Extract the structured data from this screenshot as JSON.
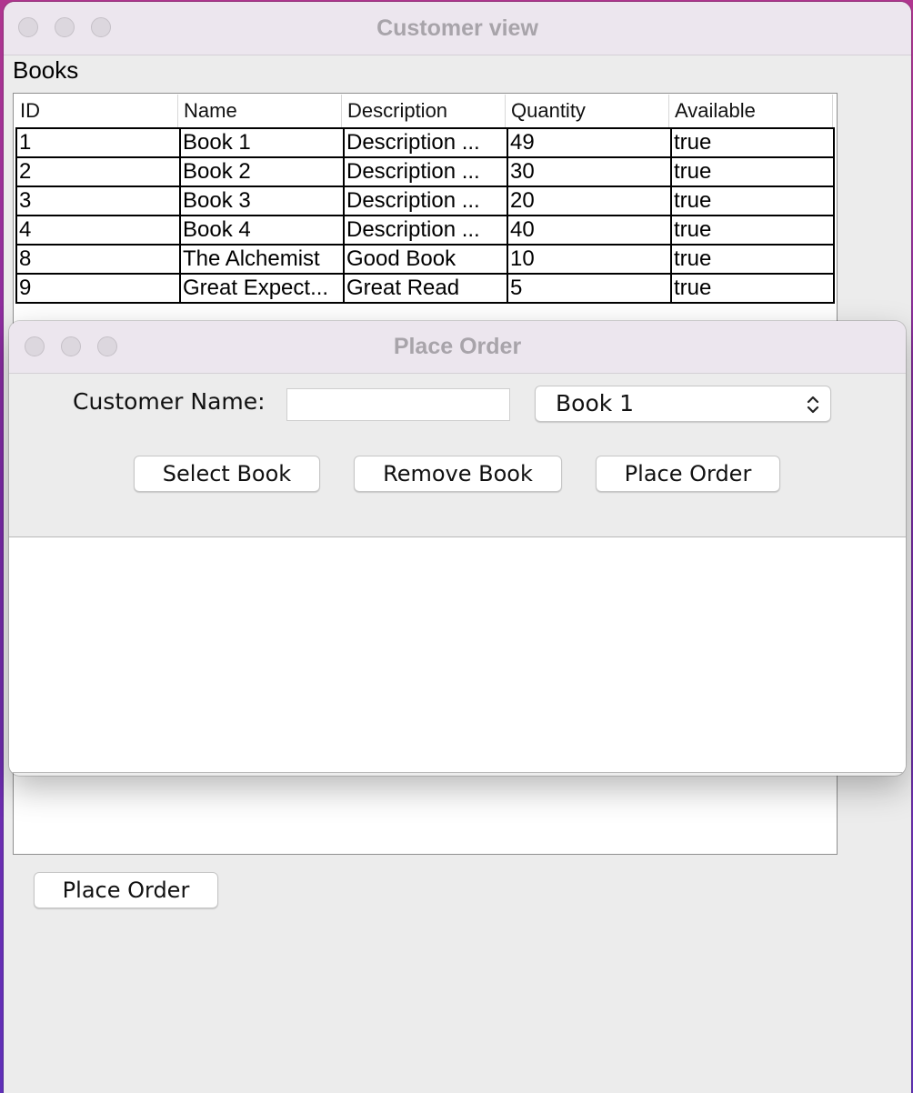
{
  "main_window": {
    "title": "Customer view",
    "books_heading": "Books",
    "place_order_label": "Place Order"
  },
  "table": {
    "columns": [
      "ID",
      "Name",
      "Description",
      "Quantity",
      "Available"
    ],
    "rows": [
      [
        "1",
        "Book 1",
        "Description ...",
        "49",
        "true"
      ],
      [
        "2",
        "Book 2",
        "Description ...",
        "30",
        "true"
      ],
      [
        "3",
        "Book 3",
        "Description ...",
        "20",
        "true"
      ],
      [
        "4",
        "Book 4",
        "Description ...",
        "40",
        "true"
      ],
      [
        "8",
        "The Alchemist",
        "Good Book",
        "10",
        "true"
      ],
      [
        "9",
        "Great Expect...",
        "Great Read",
        "5",
        "true"
      ]
    ]
  },
  "dialog": {
    "title": "Place Order",
    "customer_name_label": "Customer Name:",
    "customer_name_value": "",
    "book_select_value": "Book 1",
    "select_book_label": "Select Book",
    "remove_book_label": "Remove Book",
    "place_order_label": "Place Order"
  },
  "icons": {
    "traffic_lights": [
      "close-icon",
      "minimize-icon",
      "zoom-icon"
    ],
    "select_indicator": "chevron-up-down-icon"
  },
  "colors": {
    "window_bg": "#ececec",
    "titlebar_bg": "#ece6ee",
    "title_text": "#a8a4aa",
    "desktop_accent": "#b0358f"
  }
}
